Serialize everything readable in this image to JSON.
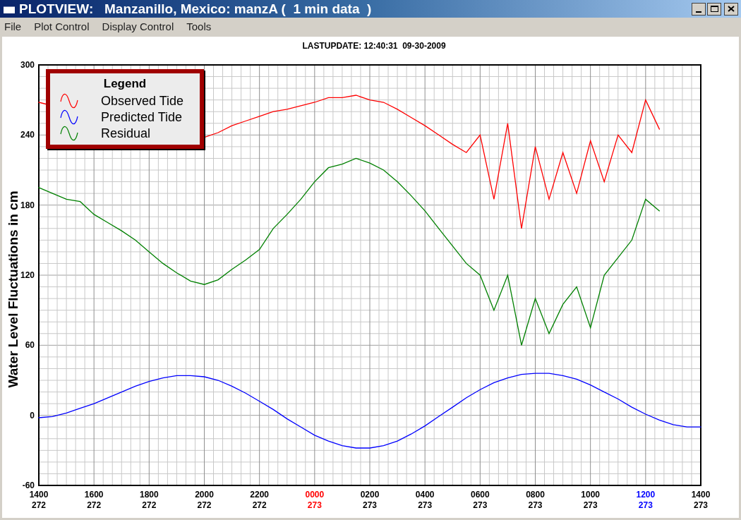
{
  "window": {
    "title": "PLOTVIEW:   Manzanillo, Mexico: manzA (  1 min data  )"
  },
  "menu": [
    {
      "label": "File"
    },
    {
      "label": "Plot Control"
    },
    {
      "label": "Display Control"
    },
    {
      "label": "Tools"
    }
  ],
  "last_update": "LASTUPDATE: 12:40:31  09-30-2009",
  "chart_data": {
    "type": "line",
    "ylabel": "Water Level Fluctuations in cm",
    "legend_title": "Legend",
    "grid": true,
    "series": [
      {
        "name": "Observed Tide",
        "color": "#ff0000",
        "values": [
          268,
          null,
          null,
          null,
          null,
          null,
          null,
          null,
          null,
          null,
          null,
          null,
          238,
          242,
          248,
          252,
          256,
          260,
          262,
          265,
          268,
          272,
          272,
          274,
          270,
          268,
          262,
          255,
          248,
          240,
          232,
          225,
          240,
          185,
          250,
          160,
          230,
          185,
          225,
          190,
          235,
          200,
          240,
          225,
          270,
          245,
          null,
          null,
          null
        ]
      },
      {
        "name": "Predicted Tide",
        "color": "#0000ff",
        "values": [
          -2,
          -1,
          2,
          6,
          10,
          15,
          20,
          25,
          29,
          32,
          34,
          34,
          33,
          30,
          25,
          19,
          12,
          5,
          -3,
          -10,
          -17,
          -22,
          -26,
          -28,
          -28,
          -26,
          -22,
          -16,
          -9,
          -1,
          7,
          15,
          22,
          28,
          32,
          35,
          36,
          36,
          34,
          31,
          26,
          20,
          14,
          7,
          1,
          -4,
          -8,
          -10,
          -10
        ]
      },
      {
        "name": "Residual",
        "color": "#008000",
        "values": [
          195,
          190,
          185,
          183,
          172,
          165,
          158,
          150,
          140,
          130,
          122,
          115,
          112,
          116,
          125,
          133,
          142,
          160,
          172,
          185,
          200,
          212,
          215,
          220,
          216,
          210,
          200,
          188,
          175,
          160,
          145,
          130,
          120,
          90,
          120,
          60,
          100,
          70,
          95,
          110,
          75,
          120,
          135,
          150,
          185,
          175,
          null,
          null,
          null
        ]
      }
    ],
    "categories": [
      "1400\n272",
      null,
      null,
      null,
      "1600\n272",
      null,
      null,
      null,
      "1800\n272",
      null,
      null,
      null,
      "2000\n272",
      null,
      null,
      null,
      "2200\n272",
      null,
      null,
      null,
      "0000\n273",
      null,
      null,
      null,
      "0200\n273",
      null,
      null,
      null,
      "0400\n273",
      null,
      null,
      null,
      "0600\n273",
      null,
      null,
      null,
      "0800\n273",
      null,
      null,
      null,
      "1000\n273",
      null,
      null,
      null,
      "1200\n273",
      null,
      null,
      null,
      "1400\n273"
    ],
    "ylim": [
      -60,
      300
    ],
    "yticks": [
      -60,
      0,
      60,
      120,
      180,
      240,
      300
    ]
  },
  "x_axis_labels": [
    {
      "color": "#000000"
    },
    {
      "color": "#000000"
    },
    {
      "color": "#000000"
    },
    {
      "color": "#000000"
    },
    {
      "color": "#000000"
    },
    {
      "color": "#ff0000"
    },
    {
      "color": "#000000"
    },
    {
      "color": "#000000"
    },
    {
      "color": "#000000"
    },
    {
      "color": "#000000"
    },
    {
      "color": "#000000"
    },
    {
      "color": "#0000ff"
    },
    {
      "color": "#000000"
    }
  ]
}
